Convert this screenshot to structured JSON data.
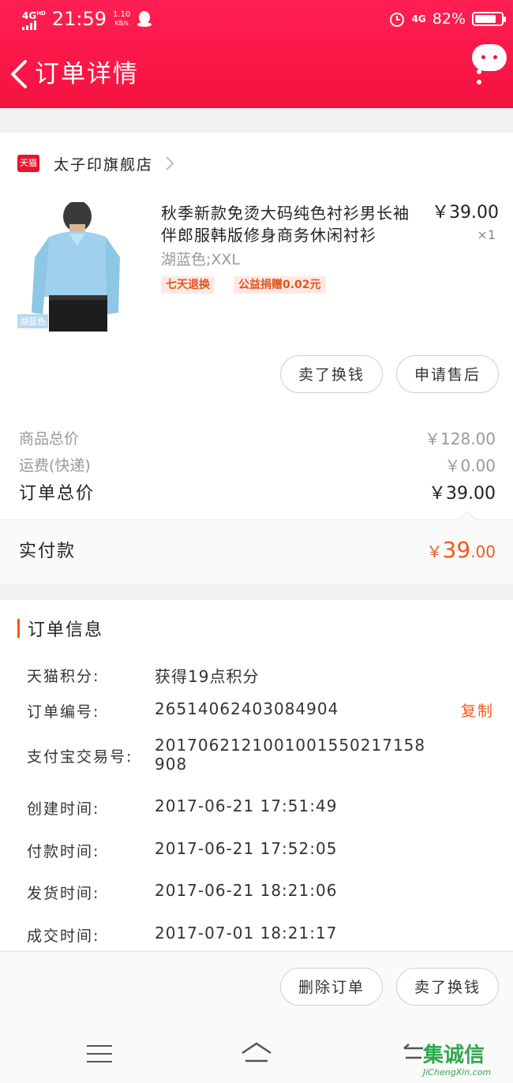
{
  "status_bar": {
    "network": "4G",
    "network_sup": "HD",
    "time": "21:59",
    "speed": "1.10",
    "speed_unit": "KB/s",
    "net_right": "4G",
    "battery": "82%",
    "battery_level": 0.82
  },
  "header": {
    "title": "订单详情"
  },
  "shop": {
    "badge": "天猫",
    "name": "太子印旗舰店"
  },
  "product": {
    "title": "秋季新款免烫大码纯色衬衫男长袖伴郎服韩版修身商务休闲衬衫",
    "price": "￥39.00",
    "qty": "×1",
    "sku": "湖蓝色;XXL",
    "image_label": "湖蓝色",
    "tags": [
      "七天退换",
      "公益捐赠0.02元"
    ]
  },
  "actions": {
    "sell": "卖了换钱",
    "after_sale": "申请售后"
  },
  "summary": {
    "goods_label": "商品总价",
    "goods_value": "￥128.00",
    "shipping_label": "运费(快递)",
    "shipping_value": "￥0.00",
    "total_label": "订单总价",
    "total_value": "￥39.00",
    "paid_label": "实付款",
    "paid_symbol": "￥",
    "paid_int": "39",
    "paid_dec": ".00"
  },
  "order_info": {
    "title": "订单信息",
    "copy_label": "复制",
    "rows": [
      {
        "label": "天猫积分:",
        "value": "获得19点积分"
      },
      {
        "label": "订单编号:",
        "value": "26514062403084904"
      },
      {
        "label": "支付宝交易号:",
        "value": "2017062121001001550217158908"
      },
      {
        "label": "创建时间:",
        "value": "2017-06-21 17:51:49"
      },
      {
        "label": "付款时间:",
        "value": "2017-06-21 17:52:05"
      },
      {
        "label": "发货时间:",
        "value": "2017-06-21 18:21:06"
      },
      {
        "label": "成交时间:",
        "value": "2017-07-01 18:21:17"
      }
    ]
  },
  "bottom_actions": {
    "delete": "删除订单",
    "sell": "卖了换钱"
  },
  "watermark": {
    "text": "JiChengXin.com",
    "logo": "集诚信"
  },
  "colors": {
    "header": "#f4123f",
    "accent": "#f4581d",
    "paid": "#f4581d"
  }
}
